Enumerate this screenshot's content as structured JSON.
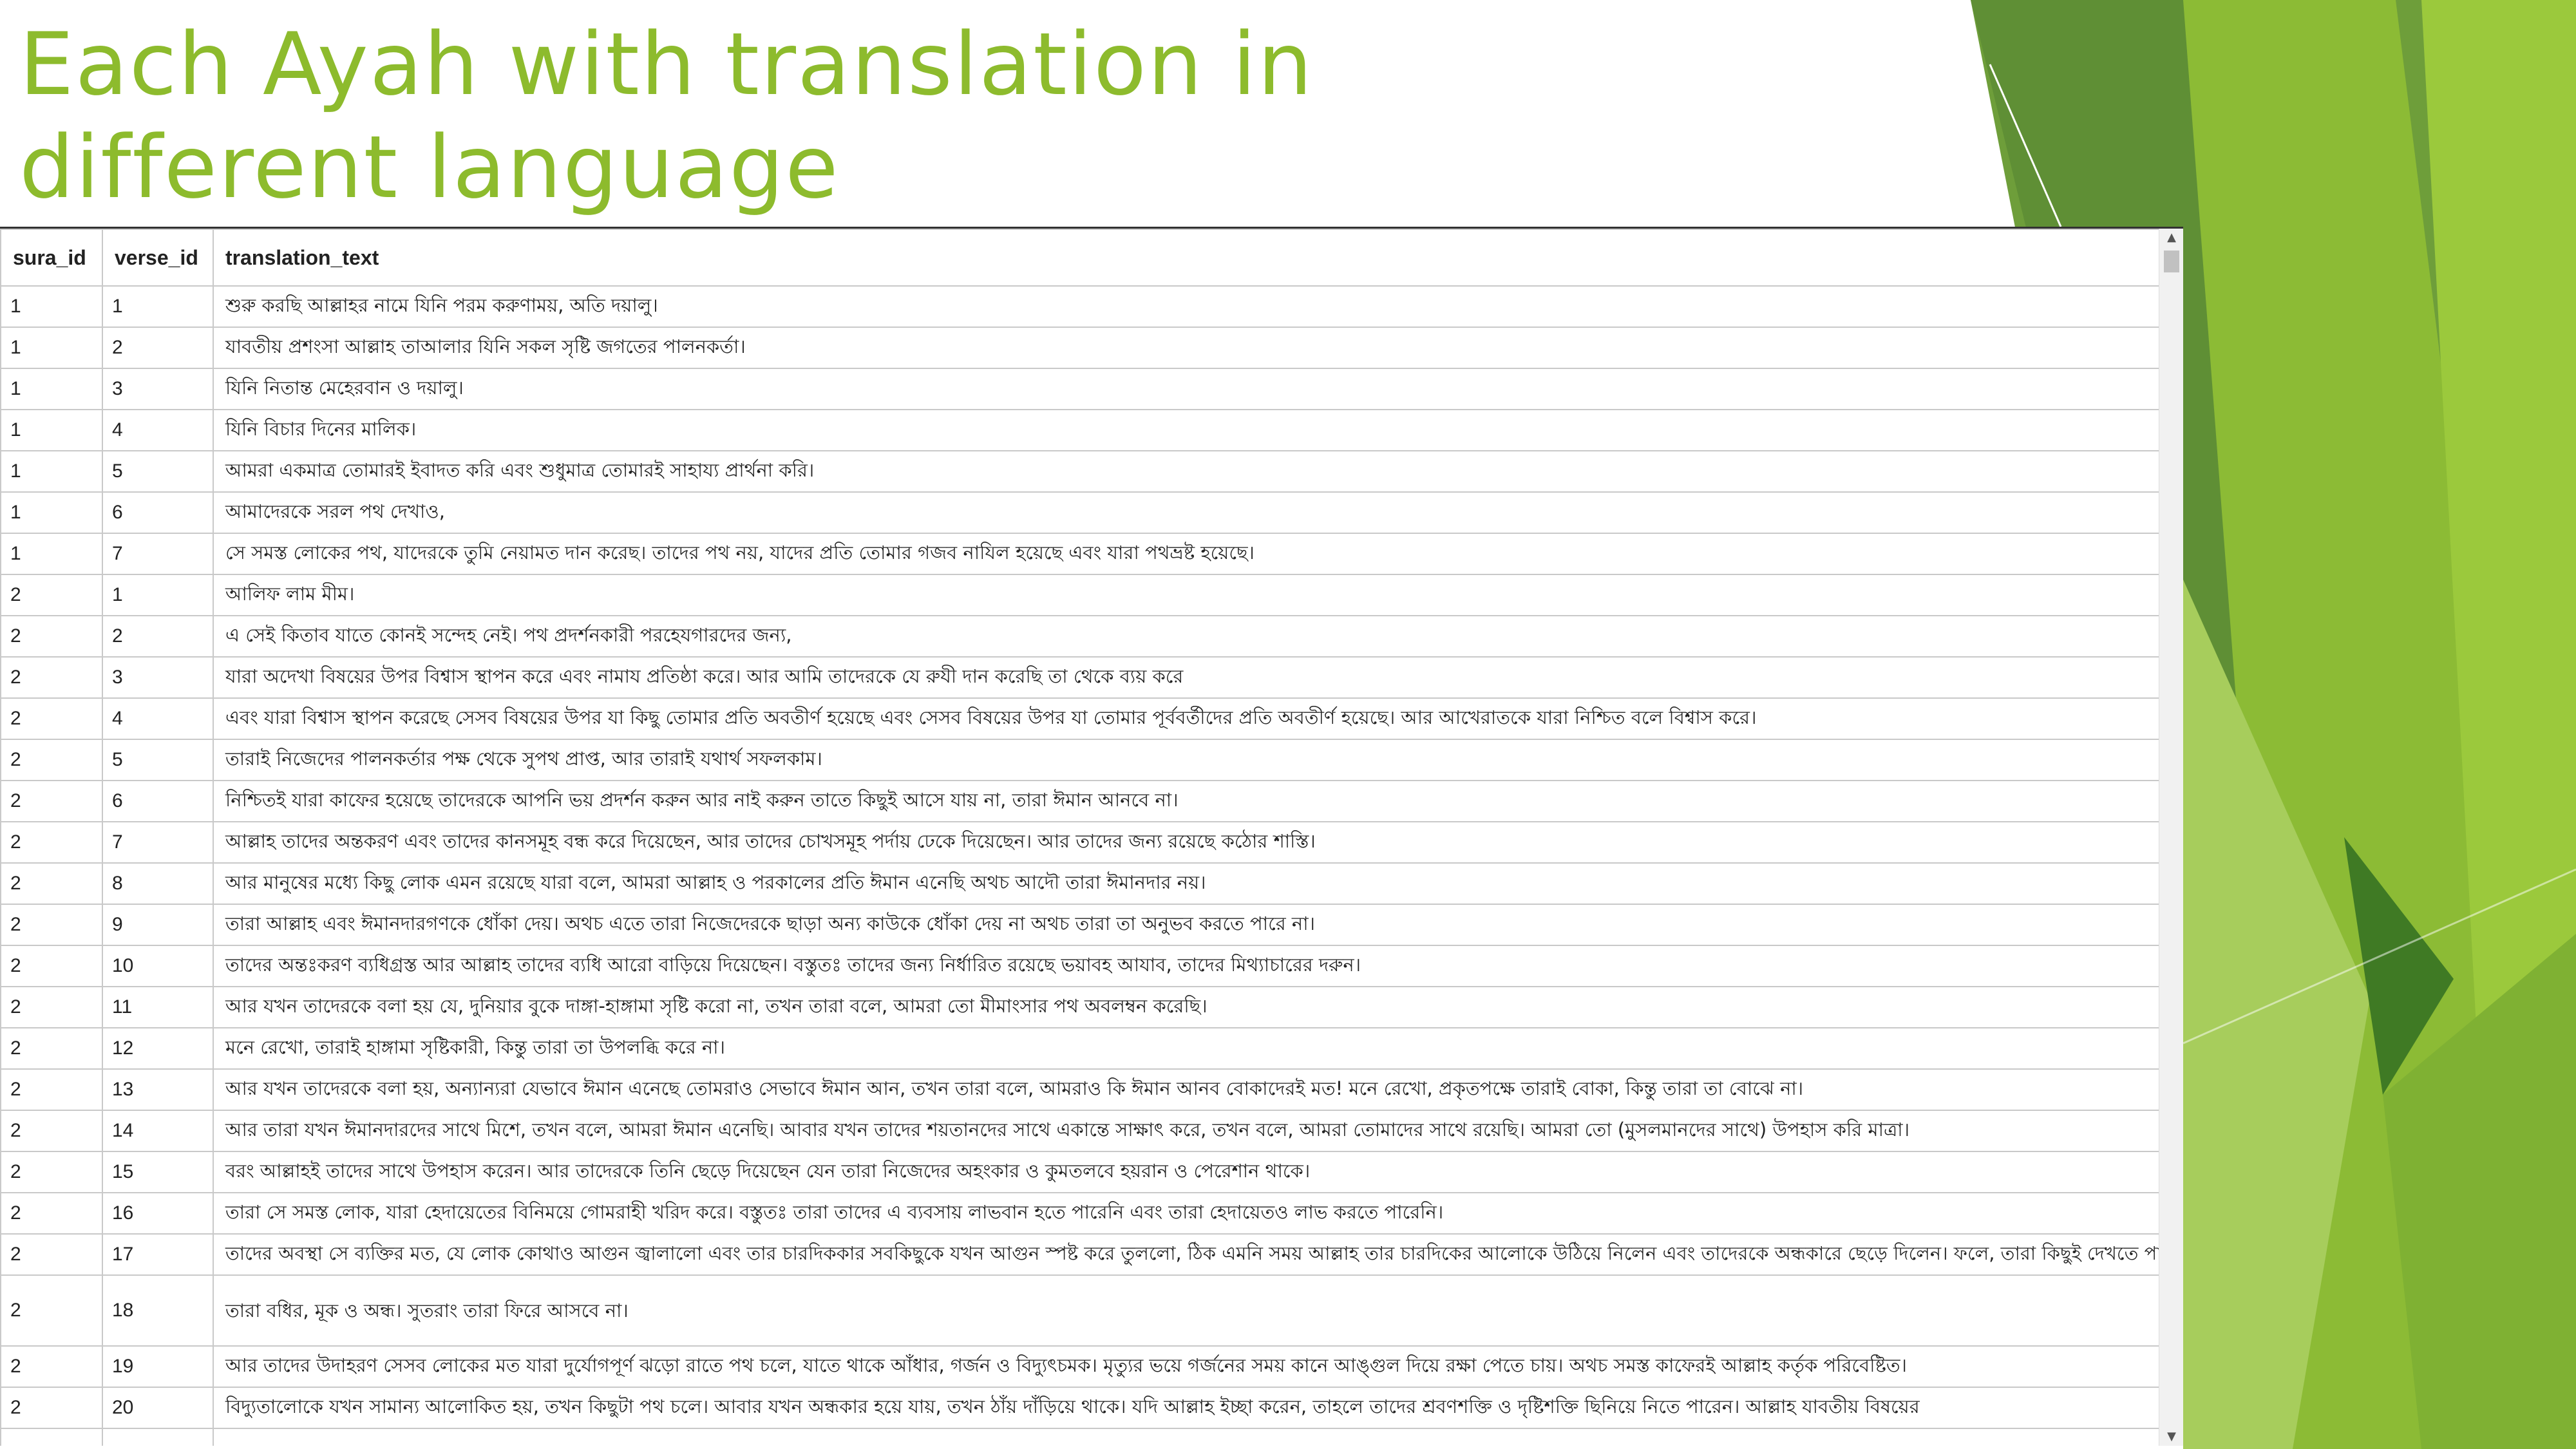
{
  "slide": {
    "title": "Each Ayah with translation in different language",
    "accent_color": "#8dbb2d"
  },
  "table": {
    "columns": [
      "sura_id",
      "verse_id",
      "translation_text"
    ],
    "rows": [
      {
        "sura_id": "1",
        "verse_id": "1",
        "text": "শুরু করছি আল্লাহর নামে যিনি পরম করুণাময়, অতি দয়ালু।"
      },
      {
        "sura_id": "1",
        "verse_id": "2",
        "text": "যাবতীয় প্রশংসা আল্লাহ তাআলার যিনি সকল সৃষ্টি জগতের পালনকর্তা।"
      },
      {
        "sura_id": "1",
        "verse_id": "3",
        "text": "যিনি নিতান্ত মেহেরবান ও দয়ালু।"
      },
      {
        "sura_id": "1",
        "verse_id": "4",
        "text": "যিনি বিচার দিনের মালিক।"
      },
      {
        "sura_id": "1",
        "verse_id": "5",
        "text": "আমরা একমাত্র তোমারই ইবাদত করি এবং শুধুমাত্র তোমারই সাহায্য প্রার্থনা করি।"
      },
      {
        "sura_id": "1",
        "verse_id": "6",
        "text": "আমাদেরকে সরল পথ দেখাও,"
      },
      {
        "sura_id": "1",
        "verse_id": "7",
        "text": "সে সমস্ত লোকের পথ, যাদেরকে তুমি নেয়ামত দান করেছ। তাদের পথ নয়, যাদের প্রতি তোমার গজব নাযিল হয়েছে এবং যারা পথভ্রষ্ট হয়েছে।"
      },
      {
        "sura_id": "2",
        "verse_id": "1",
        "text": "আলিফ লাম মীম।"
      },
      {
        "sura_id": "2",
        "verse_id": "2",
        "text": "এ সেই কিতাব যাতে কোনই সন্দেহ নেই। পথ প্রদর্শনকারী পরহেযগারদের জন্য,"
      },
      {
        "sura_id": "2",
        "verse_id": "3",
        "text": "যারা অদেখা বিষয়ের উপর বিশ্বাস স্থাপন করে এবং নামায প্রতিষ্ঠা করে। আর আমি তাদেরকে যে রুযী দান করেছি তা থেকে ব্যয় করে"
      },
      {
        "sura_id": "2",
        "verse_id": "4",
        "text": "এবং যারা বিশ্বাস স্থাপন করেছে সেসব বিষয়ের উপর যা কিছু তোমার প্রতি অবতীর্ণ হয়েছে এবং সেসব বিষয়ের উপর যা তোমার পূর্ববর্তীদের প্রতি অবতীর্ণ হয়েছে। আর আখেরাতকে যারা নিশ্চিত বলে বিশ্বাস করে।"
      },
      {
        "sura_id": "2",
        "verse_id": "5",
        "text": "তারাই নিজেদের পালনকর্তার পক্ষ থেকে সুপথ প্রাপ্ত, আর তারাই যথার্থ সফলকাম।"
      },
      {
        "sura_id": "2",
        "verse_id": "6",
        "text": "নিশ্চিতই যারা কাফের হয়েছে তাদেরকে আপনি ভয় প্রদর্শন করুন আর নাই করুন তাতে কিছুই আসে যায় না, তারা ঈমান আনবে না।"
      },
      {
        "sura_id": "2",
        "verse_id": "7",
        "text": "আল্লাহ তাদের অন্তকরণ এবং তাদের কানসমূহ বন্ধ করে দিয়েছেন, আর তাদের চোখসমূহ পর্দায় ঢেকে দিয়েছেন। আর তাদের জন্য রয়েছে কঠোর শাস্তি।"
      },
      {
        "sura_id": "2",
        "verse_id": "8",
        "text": "আর মানুষের মধ্যে কিছু লোক এমন রয়েছে যারা বলে, আমরা আল্লাহ ও পরকালের প্রতি ঈমান এনেছি অথচ আদৌ তারা ঈমানদার নয়।"
      },
      {
        "sura_id": "2",
        "verse_id": "9",
        "text": "তারা আল্লাহ এবং ঈমানদারগণকে ধোঁকা দেয়। অথচ এতে তারা নিজেদেরকে ছাড়া অন্য কাউকে ধোঁকা দেয় না অথচ তারা তা অনুভব করতে পারে না।"
      },
      {
        "sura_id": "2",
        "verse_id": "10",
        "text": "তাদের অন্তঃকরণ ব্যধিগ্রস্ত আর আল্লাহ তাদের ব্যধি আরো বাড়িয়ে দিয়েছেন। বস্তুতঃ তাদের জন্য নির্ধারিত রয়েছে ভয়াবহ আযাব, তাদের মিথ্যাচারের দরুন।"
      },
      {
        "sura_id": "2",
        "verse_id": "11",
        "text": "আর যখন তাদেরকে বলা হয় যে, দুনিয়ার বুকে দাঙ্গা-হাঙ্গামা সৃষ্টি করো না, তখন তারা বলে, আমরা তো মীমাংসার পথ অবলম্বন করেছি।"
      },
      {
        "sura_id": "2",
        "verse_id": "12",
        "text": "মনে রেখো, তারাই হাঙ্গামা সৃষ্টিকারী, কিন্তু তারা তা উপলব্ধি করে না।"
      },
      {
        "sura_id": "2",
        "verse_id": "13",
        "text": "আর যখন তাদেরকে বলা হয়, অন্যান্যরা যেভাবে ঈমান এনেছে তোমরাও সেভাবে ঈমান আন, তখন তারা বলে, আমরাও কি ঈমান আনব বোকাদেরই মত! মনে রেখো, প্রকৃতপক্ষে তারাই বোকা, কিন্তু তারা তা বোঝে না।"
      },
      {
        "sura_id": "2",
        "verse_id": "14",
        "text": "আর তারা যখন ঈমানদারদের সাথে মিশে, তখন বলে, আমরা ঈমান এনেছি। আবার যখন তাদের শয়তানদের সাথে একান্তে সাক্ষাৎ করে, তখন বলে, আমরা তোমাদের সাথে রয়েছি। আমরা তো (মুসলমানদের সাথে) উপহাস করি মাত্রা।"
      },
      {
        "sura_id": "2",
        "verse_id": "15",
        "text": "বরং আল্লাহই তাদের সাথে উপহাস করেন। আর তাদেরকে তিনি ছেড়ে দিয়েছেন যেন তারা নিজেদের অহংকার ও কুমতলবে হয়রান ও পেরেশান থাকে।"
      },
      {
        "sura_id": "2",
        "verse_id": "16",
        "text": "তারা সে সমস্ত লোক, যারা হেদায়েতের বিনিময়ে গোমরাহী খরিদ করে। বস্তুতঃ তারা তাদের এ ব্যবসায় লাভবান হতে পারেনি এবং তারা হেদায়েতও লাভ করতে পারেনি।"
      },
      {
        "sura_id": "2",
        "verse_id": "17",
        "text": "তাদের অবস্থা সে ব্যক্তির মত, যে লোক কোথাও আগুন জ্বালালো এবং তার চারদিককার সবকিছুকে যখন আগুন স্পষ্ট করে তুললো, ঠিক এমনি সময় আল্লাহ তার চারদিকের আলোকে উঠিয়ে নিলেন এবং তাদেরকে অন্ধকারে ছেড়ে দিলেন। ফলে, তারা কিছুই দেখতে পায় না।"
      },
      {
        "sura_id": "2",
        "verse_id": "18",
        "text": "তারা বধির, মূক ও অন্ধ। সুতরাং তারা ফিরে আসবে না।"
      },
      {
        "sura_id": "2",
        "verse_id": "19",
        "text": "আর তাদের উদাহরণ সেসব লোকের মত যারা দুর্যোগপূর্ণ ঝড়ো রাতে পথ চলে, যাতে থাকে আঁধার, গর্জন ও বিদ্যুৎচমক। মৃত্যুর ভয়ে গর্জনের সময় কানে আঙ্গুল দিয়ে রক্ষা পেতে চায়। অথচ সমস্ত কাফেরই আল্লাহ কর্তৃক পরিবেষ্টিত।"
      },
      {
        "sura_id": "2",
        "verse_id": "20",
        "text": "বিদ্যুতালোকে যখন সামান্য আলোকিত হয়, তখন কিছুটা পথ চলে। আবার যখন অন্ধকার হয়ে যায়, তখন ঠাঁয় দাঁড়িয়ে থাকে। যদি আল্লাহ ইচ্ছা করেন, তাহলে তাদের শ্রবণশক্তি ও দৃষ্টিশক্তি ছিনিয়ে নিতে পারেন। আল্লাহ যাবতীয় বিষয়ের"
      }
    ]
  }
}
